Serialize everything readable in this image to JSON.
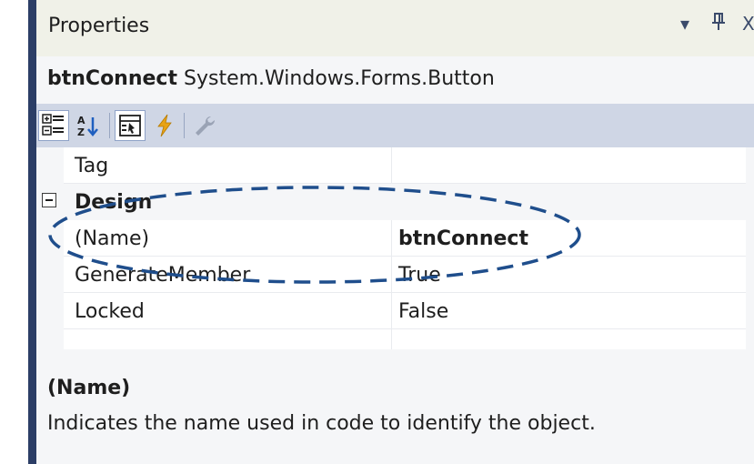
{
  "panel": {
    "title": "Properties",
    "title_buttons": [
      "▾",
      "⊥",
      "X"
    ]
  },
  "object": {
    "name": "btnConnect",
    "type": "System.Windows.Forms.Button"
  },
  "toolbar": {
    "buttons": [
      {
        "name": "categorized-icon",
        "active": true
      },
      {
        "name": "alphabetical-icon",
        "active": false
      },
      {
        "name": "properties-icon",
        "active": true
      },
      {
        "name": "events-icon",
        "active": false
      },
      {
        "name": "property-pages-icon",
        "active": false
      }
    ]
  },
  "grid": {
    "rows_before": [
      {
        "label": "Tag",
        "value": ""
      }
    ],
    "category": {
      "label": "Design",
      "expanded": true
    },
    "rows": [
      {
        "label": "(Name)",
        "value": "btnConnect",
        "bold": true
      },
      {
        "label": "GenerateMember",
        "value": "True",
        "bold": false
      },
      {
        "label": "Locked",
        "value": "False",
        "bold": false
      }
    ]
  },
  "description": {
    "title": "(Name)",
    "text": "Indicates the name used in code to identify the object."
  },
  "colors": {
    "left_bar": "#2c3e66",
    "toolbar_bg": "#cfd6e5",
    "annotation": "#1f4e8c"
  }
}
